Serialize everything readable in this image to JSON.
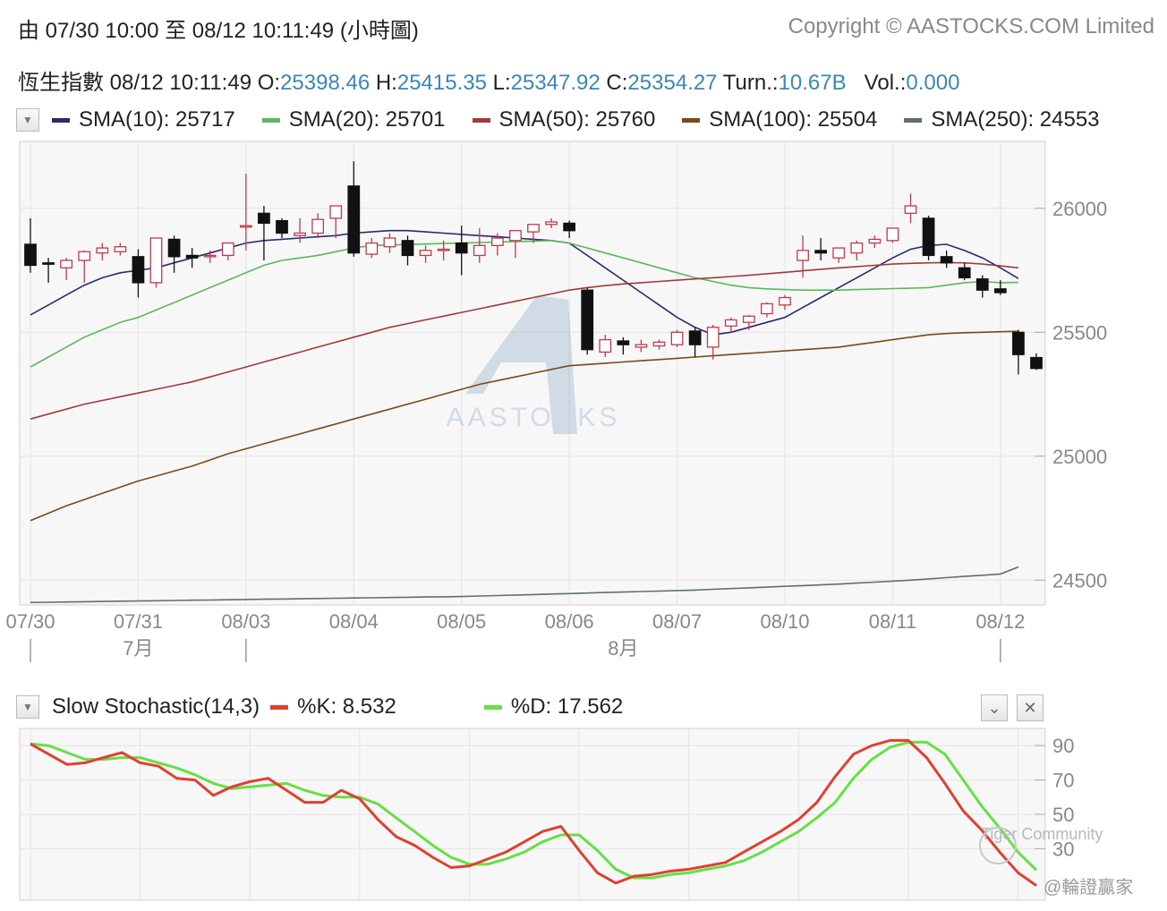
{
  "header": {
    "range_text": "由  07/30 10:00 至  08/12 10:11:49 (小時圖)",
    "copyright": "Copyright © AASTOCKS.COM Limited"
  },
  "quote": {
    "name": "恆生指數",
    "datetime": "08/12 10:11:49",
    "open_label": "O:",
    "open": "25398.46",
    "high_label": "H:",
    "high": "25415.35",
    "low_label": "L:",
    "low": "25347.92",
    "close_label": "C:",
    "close": "25354.27",
    "turnover_label": "Turn.:",
    "turnover": "10.67B",
    "volume_label": "Vol.:",
    "volume": "0.000"
  },
  "sma_legend": [
    {
      "label": "SMA(10): 25717",
      "color": "#2a2a6e"
    },
    {
      "label": "SMA(20): 25701",
      "color": "#5cb85c"
    },
    {
      "label": "SMA(50): 25760",
      "color": "#a03a3a"
    },
    {
      "label": "SMA(100): 25504",
      "color": "#7a4a1a"
    },
    {
      "label": "SMA(250): 24553",
      "color": "#5f7070"
    }
  ],
  "stoch_legend": {
    "title": "Slow Stochastic(14,3)",
    "k_label": "%K: 8.532",
    "k_color": "#e04030",
    "d_label": "%D: 17.562",
    "d_color": "#66e044"
  },
  "watermark": {
    "brand": "AASTOCKS",
    "tiger": "Tiger Community",
    "handle": "@輪證贏家"
  },
  "icons": {
    "dropdown": "chevron-down-icon",
    "collapse": "collapse-icon",
    "close": "close-icon"
  },
  "chart_data": [
    {
      "type": "candlestick",
      "ylim": [
        24400,
        26270
      ],
      "y_ticks": [
        24500,
        25000,
        25500,
        26000
      ],
      "x_tick_labels": [
        {
          "label": "07/30",
          "index": 0
        },
        {
          "label": "07/31",
          "index": 6
        },
        {
          "label": "08/03",
          "index": 12
        },
        {
          "label": "08/04",
          "index": 18
        },
        {
          "label": "08/05",
          "index": 24
        },
        {
          "label": "08/06",
          "index": 30
        },
        {
          "label": "08/07",
          "index": 36
        },
        {
          "label": "08/10",
          "index": 42
        },
        {
          "label": "08/11",
          "index": 48
        },
        {
          "label": "08/12",
          "index": 54
        }
      ],
      "month_labels": [
        {
          "label": "7月",
          "index": 6
        },
        {
          "label": "8月",
          "index": 33
        }
      ],
      "candles": [
        {
          "o": 25855,
          "h": 25960,
          "l": 25740,
          "c": 25770
        },
        {
          "o": 25780,
          "h": 25800,
          "l": 25700,
          "c": 25775
        },
        {
          "o": 25760,
          "h": 25800,
          "l": 25710,
          "c": 25790
        },
        {
          "o": 25790,
          "h": 25830,
          "l": 25700,
          "c": 25825
        },
        {
          "o": 25820,
          "h": 25860,
          "l": 25790,
          "c": 25840
        },
        {
          "o": 25825,
          "h": 25860,
          "l": 25810,
          "c": 25845
        },
        {
          "o": 25805,
          "h": 25835,
          "l": 25640,
          "c": 25700
        },
        {
          "o": 25700,
          "h": 25880,
          "l": 25680,
          "c": 25880
        },
        {
          "o": 25875,
          "h": 25890,
          "l": 25740,
          "c": 25805
        },
        {
          "o": 25810,
          "h": 25840,
          "l": 25760,
          "c": 25800
        },
        {
          "o": 25810,
          "h": 25830,
          "l": 25780,
          "c": 25810
        },
        {
          "o": 25810,
          "h": 25860,
          "l": 25790,
          "c": 25860
        },
        {
          "o": 25930,
          "h": 26140,
          "l": 25830,
          "c": 25930
        },
        {
          "o": 25980,
          "h": 26010,
          "l": 25790,
          "c": 25940
        },
        {
          "o": 25950,
          "h": 25960,
          "l": 25880,
          "c": 25900
        },
        {
          "o": 25890,
          "h": 25960,
          "l": 25860,
          "c": 25900
        },
        {
          "o": 25900,
          "h": 25980,
          "l": 25880,
          "c": 25955
        },
        {
          "o": 25960,
          "h": 26010,
          "l": 25880,
          "c": 26010
        },
        {
          "o": 26090,
          "h": 26190,
          "l": 25805,
          "c": 25820
        },
        {
          "o": 25815,
          "h": 25880,
          "l": 25800,
          "c": 25860
        },
        {
          "o": 25845,
          "h": 25900,
          "l": 25820,
          "c": 25880
        },
        {
          "o": 25870,
          "h": 25890,
          "l": 25770,
          "c": 25810
        },
        {
          "o": 25810,
          "h": 25850,
          "l": 25780,
          "c": 25830
        },
        {
          "o": 25830,
          "h": 25870,
          "l": 25790,
          "c": 25835
        },
        {
          "o": 25860,
          "h": 25930,
          "l": 25730,
          "c": 25820
        },
        {
          "o": 25810,
          "h": 25920,
          "l": 25780,
          "c": 25850
        },
        {
          "o": 25850,
          "h": 25900,
          "l": 25810,
          "c": 25880
        },
        {
          "o": 25870,
          "h": 25910,
          "l": 25800,
          "c": 25910
        },
        {
          "o": 25905,
          "h": 25930,
          "l": 25860,
          "c": 25935
        },
        {
          "o": 25935,
          "h": 25960,
          "l": 25920,
          "c": 25945
        },
        {
          "o": 25940,
          "h": 25950,
          "l": 25880,
          "c": 25910
        },
        {
          "o": 25670,
          "h": 25680,
          "l": 25410,
          "c": 25430
        },
        {
          "o": 25420,
          "h": 25490,
          "l": 25400,
          "c": 25470
        },
        {
          "o": 25465,
          "h": 25480,
          "l": 25410,
          "c": 25450
        },
        {
          "o": 25440,
          "h": 25470,
          "l": 25420,
          "c": 25450
        },
        {
          "o": 25445,
          "h": 25470,
          "l": 25430,
          "c": 25460
        },
        {
          "o": 25450,
          "h": 25510,
          "l": 25440,
          "c": 25500
        },
        {
          "o": 25505,
          "h": 25520,
          "l": 25400,
          "c": 25450
        },
        {
          "o": 25440,
          "h": 25530,
          "l": 25390,
          "c": 25520
        },
        {
          "o": 25525,
          "h": 25560,
          "l": 25500,
          "c": 25550
        },
        {
          "o": 25540,
          "h": 25570,
          "l": 25510,
          "c": 25565
        },
        {
          "o": 25575,
          "h": 25620,
          "l": 25560,
          "c": 25615
        },
        {
          "o": 25610,
          "h": 25650,
          "l": 25590,
          "c": 25640
        },
        {
          "o": 25790,
          "h": 25890,
          "l": 25720,
          "c": 25830
        },
        {
          "o": 25830,
          "h": 25880,
          "l": 25790,
          "c": 25820
        },
        {
          "o": 25800,
          "h": 25840,
          "l": 25780,
          "c": 25840
        },
        {
          "o": 25820,
          "h": 25870,
          "l": 25790,
          "c": 25860
        },
        {
          "o": 25860,
          "h": 25890,
          "l": 25840,
          "c": 25875
        },
        {
          "o": 25870,
          "h": 25920,
          "l": 25860,
          "c": 25920
        },
        {
          "o": 25980,
          "h": 26060,
          "l": 25940,
          "c": 26010
        },
        {
          "o": 25960,
          "h": 25970,
          "l": 25790,
          "c": 25810
        },
        {
          "o": 25805,
          "h": 25830,
          "l": 25760,
          "c": 25780
        },
        {
          "o": 25760,
          "h": 25780,
          "l": 25710,
          "c": 25720
        },
        {
          "o": 25715,
          "h": 25730,
          "l": 25640,
          "c": 25670
        },
        {
          "o": 25675,
          "h": 25710,
          "l": 25650,
          "c": 25660
        },
        {
          "o": 25500,
          "h": 25510,
          "l": 25330,
          "c": 25410
        },
        {
          "o": 25398,
          "h": 25415,
          "l": 25348,
          "c": 25354
        }
      ],
      "series": [
        {
          "name": "SMA(10)",
          "color": "#2a2a6e",
          "values": [
            25570,
            25610,
            25650,
            25690,
            25720,
            25740,
            25750,
            25760,
            25780,
            25800,
            25820,
            25840,
            25860,
            25870,
            25875,
            25880,
            25885,
            25890,
            25900,
            25905,
            25910,
            25910,
            25905,
            25900,
            25895,
            25890,
            25885,
            25880,
            25875,
            25870,
            25860,
            25810,
            25760,
            25710,
            25660,
            25610,
            25560,
            25520,
            25490,
            25500,
            25520,
            25540,
            25560,
            25600,
            25640,
            25680,
            25720,
            25760,
            25800,
            25835,
            25850,
            25855,
            25830,
            25800,
            25760,
            25717
          ]
        },
        {
          "name": "SMA(20)",
          "color": "#5cb85c",
          "values": [
            25360,
            25400,
            25440,
            25480,
            25510,
            25540,
            25560,
            25590,
            25620,
            25650,
            25680,
            25710,
            25740,
            25770,
            25790,
            25800,
            25810,
            25825,
            25840,
            25850,
            25852,
            25854,
            25856,
            25858,
            25860,
            25862,
            25864,
            25866,
            25868,
            25870,
            25860,
            25840,
            25820,
            25800,
            25780,
            25760,
            25740,
            25720,
            25705,
            25690,
            25680,
            25675,
            25672,
            25670,
            25670,
            25670,
            25672,
            25674,
            25676,
            25678,
            25680,
            25690,
            25700,
            25705,
            25700,
            25701
          ]
        },
        {
          "name": "SMA(50)",
          "color": "#a03a3a",
          "values": [
            25150,
            25170,
            25190,
            25210,
            25225,
            25240,
            25255,
            25270,
            25285,
            25300,
            25320,
            25340,
            25360,
            25380,
            25400,
            25420,
            25440,
            25460,
            25480,
            25500,
            25520,
            25535,
            25550,
            25565,
            25580,
            25595,
            25610,
            25625,
            25640,
            25655,
            25670,
            25680,
            25688,
            25695,
            25700,
            25705,
            25710,
            25715,
            25720,
            25725,
            25730,
            25736,
            25742,
            25748,
            25754,
            25760,
            25765,
            25770,
            25775,
            25778,
            25780,
            25781,
            25780,
            25775,
            25768,
            25760
          ]
        },
        {
          "name": "SMA(100)",
          "color": "#7a4a1a",
          "values": [
            24740,
            24770,
            24800,
            24825,
            24850,
            24875,
            24900,
            24920,
            24940,
            24960,
            24985,
            25010,
            25030,
            25050,
            25070,
            25090,
            25110,
            25130,
            25150,
            25170,
            25190,
            25210,
            25230,
            25250,
            25270,
            25290,
            25305,
            25320,
            25335,
            25350,
            25365,
            25370,
            25375,
            25380,
            25385,
            25390,
            25395,
            25400,
            25405,
            25410,
            25415,
            25420,
            25425,
            25430,
            25435,
            25440,
            25450,
            25460,
            25470,
            25480,
            25490,
            25495,
            25498,
            25500,
            25502,
            25504
          ]
        },
        {
          "name": "SMA(250)",
          "color": "#5f7070",
          "values": [
            24410,
            24411,
            24412,
            24413,
            24414,
            24415,
            24416,
            24417,
            24418,
            24419,
            24420,
            24421,
            24422,
            24423,
            24424,
            24425,
            24426,
            24427,
            24428,
            24429,
            24430,
            24431,
            24432,
            24433,
            24434,
            24436,
            24438,
            24440,
            24442,
            24444,
            24446,
            24448,
            24450,
            24452,
            24454,
            24456,
            24458,
            24460,
            24463,
            24466,
            24469,
            24472,
            24475,
            24478,
            24481,
            24484,
            24488,
            24492,
            24496,
            24500,
            24505,
            24510,
            24515,
            24520,
            24525,
            24553
          ]
        }
      ]
    },
    {
      "type": "line",
      "title": "Slow Stochastic(14,3)",
      "ylim": [
        0,
        100
      ],
      "y_ticks": [
        30,
        50,
        70,
        90
      ],
      "series": [
        {
          "name": "%K",
          "color": "#e04030",
          "values": [
            91,
            85,
            79,
            80,
            83,
            86,
            80,
            78,
            71,
            70,
            61,
            66,
            69,
            71,
            64,
            57,
            57,
            64,
            59,
            47,
            37,
            32,
            25,
            19,
            20,
            24,
            28,
            34,
            40,
            43,
            29,
            16,
            10,
            14,
            15,
            17,
            18,
            20,
            22,
            28,
            34,
            40,
            47,
            57,
            72,
            85,
            90,
            93,
            93,
            83,
            68,
            52,
            41,
            28,
            16,
            8.532
          ]
        },
        {
          "name": "%D",
          "color": "#66e044",
          "values": [
            91,
            90,
            86,
            82,
            82,
            83,
            83,
            80,
            77,
            73,
            68,
            65,
            66,
            67,
            68,
            64,
            61,
            60,
            60,
            56,
            48,
            40,
            32,
            25,
            21,
            21,
            24,
            28,
            34,
            38,
            38,
            29,
            18,
            13,
            13,
            15,
            16,
            18,
            20,
            23,
            28,
            34,
            40,
            48,
            57,
            71,
            82,
            89,
            92,
            92,
            85,
            70,
            55,
            42,
            28,
            17.562
          ]
        }
      ]
    }
  ]
}
